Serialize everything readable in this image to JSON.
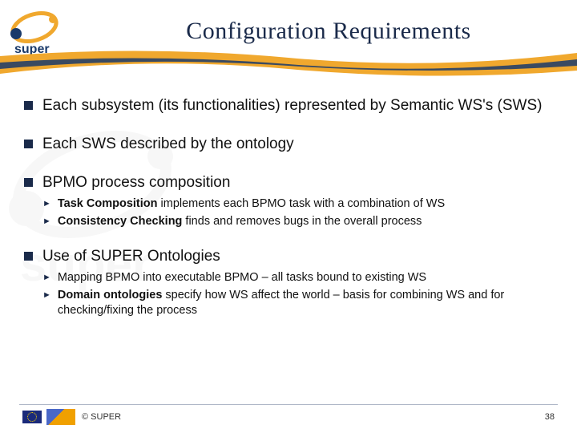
{
  "header": {
    "title": "Configuration Requirements",
    "logo_text": "super"
  },
  "bullets": [
    {
      "text": "Each subsystem (its functionalities) represented by Semantic WS's (SWS)",
      "subs": []
    },
    {
      "text": "Each SWS described by the ontology",
      "subs": []
    },
    {
      "text": "BPMO process composition",
      "subs": [
        {
          "bold": "Task Composition",
          "rest": " implements each BPMO task with a combination of WS"
        },
        {
          "bold": "Consistency Checking",
          "rest": " finds and removes bugs in the overall process"
        }
      ]
    },
    {
      "text": "Use of SUPER Ontologies",
      "subs": [
        {
          "bold": "",
          "rest": "Mapping BPMO into executable BPMO – all tasks bound to existing WS"
        },
        {
          "bold": "Domain ontologies",
          "rest": " specify how WS affect the world – basis for combining WS and for checking/fixing the process"
        }
      ]
    }
  ],
  "footer": {
    "copyright": "© SUPER",
    "page": "38"
  }
}
